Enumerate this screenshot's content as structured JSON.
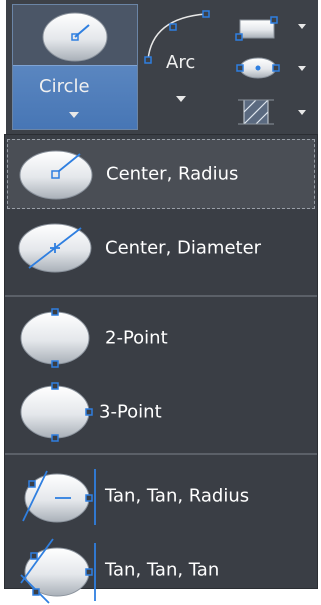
{
  "ribbon": {
    "circle_label": "Circle",
    "arc_label": "Arc"
  },
  "menu": {
    "items": [
      {
        "label": "Center, Radius",
        "icon": "circle-center-radius-icon",
        "selected": true
      },
      {
        "label": "Center, Diameter",
        "icon": "circle-center-diameter-icon",
        "selected": false
      },
      {
        "label": "2-Point",
        "icon": "circle-2-point-icon",
        "selected": false
      },
      {
        "label": "3-Point",
        "icon": "circle-3-point-icon",
        "selected": false
      },
      {
        "label": "Tan, Tan, Radius",
        "icon": "circle-tan-tan-radius-icon",
        "selected": false
      },
      {
        "label": "Tan, Tan, Tan",
        "icon": "circle-tan-tan-tan-icon",
        "selected": false
      }
    ]
  },
  "colors": {
    "ribbon_bg": "#3d4148",
    "menu_bg": "#3a3e45",
    "selected_bg": "#4a4e55",
    "button_blue": "#4776b5",
    "icon_line": "#2f7fe0"
  }
}
